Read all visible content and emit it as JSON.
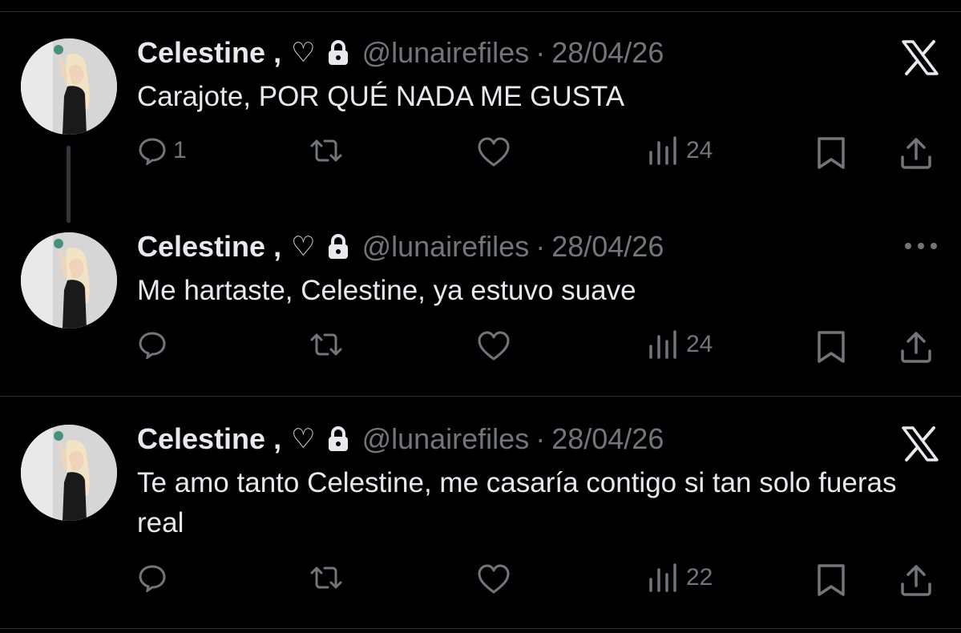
{
  "tweets": [
    {
      "name": "Celestine ,",
      "heart": "♡",
      "handle": "@lunairefiles",
      "separator": "·",
      "date": "28/04/26",
      "text": "Carajote, POR QUÉ NADA ME GUSTA",
      "corner_icon": "x-logo-icon",
      "replies": "1",
      "views": "24"
    },
    {
      "name": "Celestine ,",
      "heart": "♡",
      "handle": "@lunairefiles",
      "separator": "·",
      "date": "28/04/26",
      "text": "Me hartaste, Celestine, ya estuvo suave",
      "corner_icon": "more-options-icon",
      "replies": "",
      "views": "24"
    },
    {
      "name": "Celestine ,",
      "heart": "♡",
      "handle": "@lunairefiles",
      "separator": "·",
      "date": "28/04/26",
      "text": "Te amo tanto Celestine, me casaría contigo si tan solo fueras real",
      "corner_icon": "x-logo-icon",
      "replies": "",
      "views": "22"
    }
  ],
  "colors": {
    "background": "#000000",
    "text": "#e7e9ea",
    "muted": "#71767b",
    "border": "#2f3336"
  }
}
